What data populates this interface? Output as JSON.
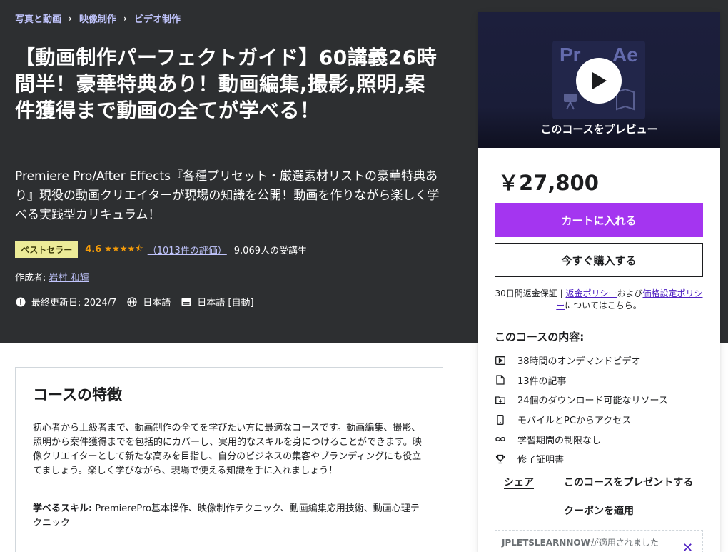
{
  "breadcrumb": [
    "写真と動画",
    "映像制作",
    "ビデオ制作"
  ],
  "course": {
    "title": "【動画制作パーフェクトガイド】60講義26時間半！豪華特典あり！動画編集,撮影,照明,案件獲得まで動画の全てが学べる！",
    "subtitle": "Premiere Pro/After Effects『各種プリセット・厳選素材リストの豪華特典あり』現役の動画クリエイターが現場の知識を公開！動画を作りながら楽しく学べる実践型カリキュラム！",
    "badge": "ベストセラー",
    "rating": "4.6",
    "rating_value": 4.6,
    "reviews": "（1013件の評価）",
    "students": "9,069人の受講生",
    "author_label": "作成者:",
    "author": "岩村 和輝",
    "updated": "最終更新日: 2024/7",
    "language": "日本語",
    "captions": "日本語 [自動]"
  },
  "sidebar": {
    "preview_label": "このコースをプレビュー",
    "preview_pr": "Pr",
    "preview_ae": "Ae",
    "price": "￥27,800",
    "add_to_cart": "カートに入れる",
    "buy_now": "今すぐ購入する",
    "guarantee_prefix": "30日間返金保証 | ",
    "refund_policy": "返金ポリシー",
    "guarantee_mid": "および",
    "pricing_policy": "価格設定ポリシー",
    "guarantee_suffix": "についてはこちら。",
    "includes_title": "このコースの内容:",
    "includes": [
      {
        "icon": "video-icon",
        "text": "38時間のオンデマンドビデオ"
      },
      {
        "icon": "file-icon",
        "text": "13件の記事"
      },
      {
        "icon": "download-icon",
        "text": "24個のダウンロード可能なリソース"
      },
      {
        "icon": "mobile-icon",
        "text": "モバイルとPCからアクセス"
      },
      {
        "icon": "infinity-icon",
        "text": "学習期間の制限なし"
      },
      {
        "icon": "trophy-icon",
        "text": "修了証明書"
      }
    ],
    "share": "シェア",
    "gift": "このコースをプレゼントする",
    "coupon": "クーポンを適用",
    "coupon_code": "JPLETSLEARNNOW",
    "coupon_applied": "が適用されました"
  },
  "features": {
    "title": "コースの特徴",
    "description": "初心者から上級者まで、動画制作の全てを学びたい方に最適なコースです。動画編集、撮影、照明から案件獲得までを包括的にカバーし、実用的なスキルを身につけることができます。映像クリエイターとして新たな高みを目指し、自分のビジネスの集客やブランディングにも役立てましょう。楽しく学びながら、現場で使える知識を手に入れましょう！",
    "skills_label": "学べるスキル:",
    "skills": "PremierePro基本操作、映像制作テクニック、動画編集応用技術、動画心理テクニック"
  },
  "colors": {
    "hero_bg": "#2d2f31",
    "accent": "#a435f0",
    "link_light": "#c0c4fc",
    "link_dark": "#5022c3",
    "star": "#f69c08",
    "badge_bg": "#eceb98"
  }
}
